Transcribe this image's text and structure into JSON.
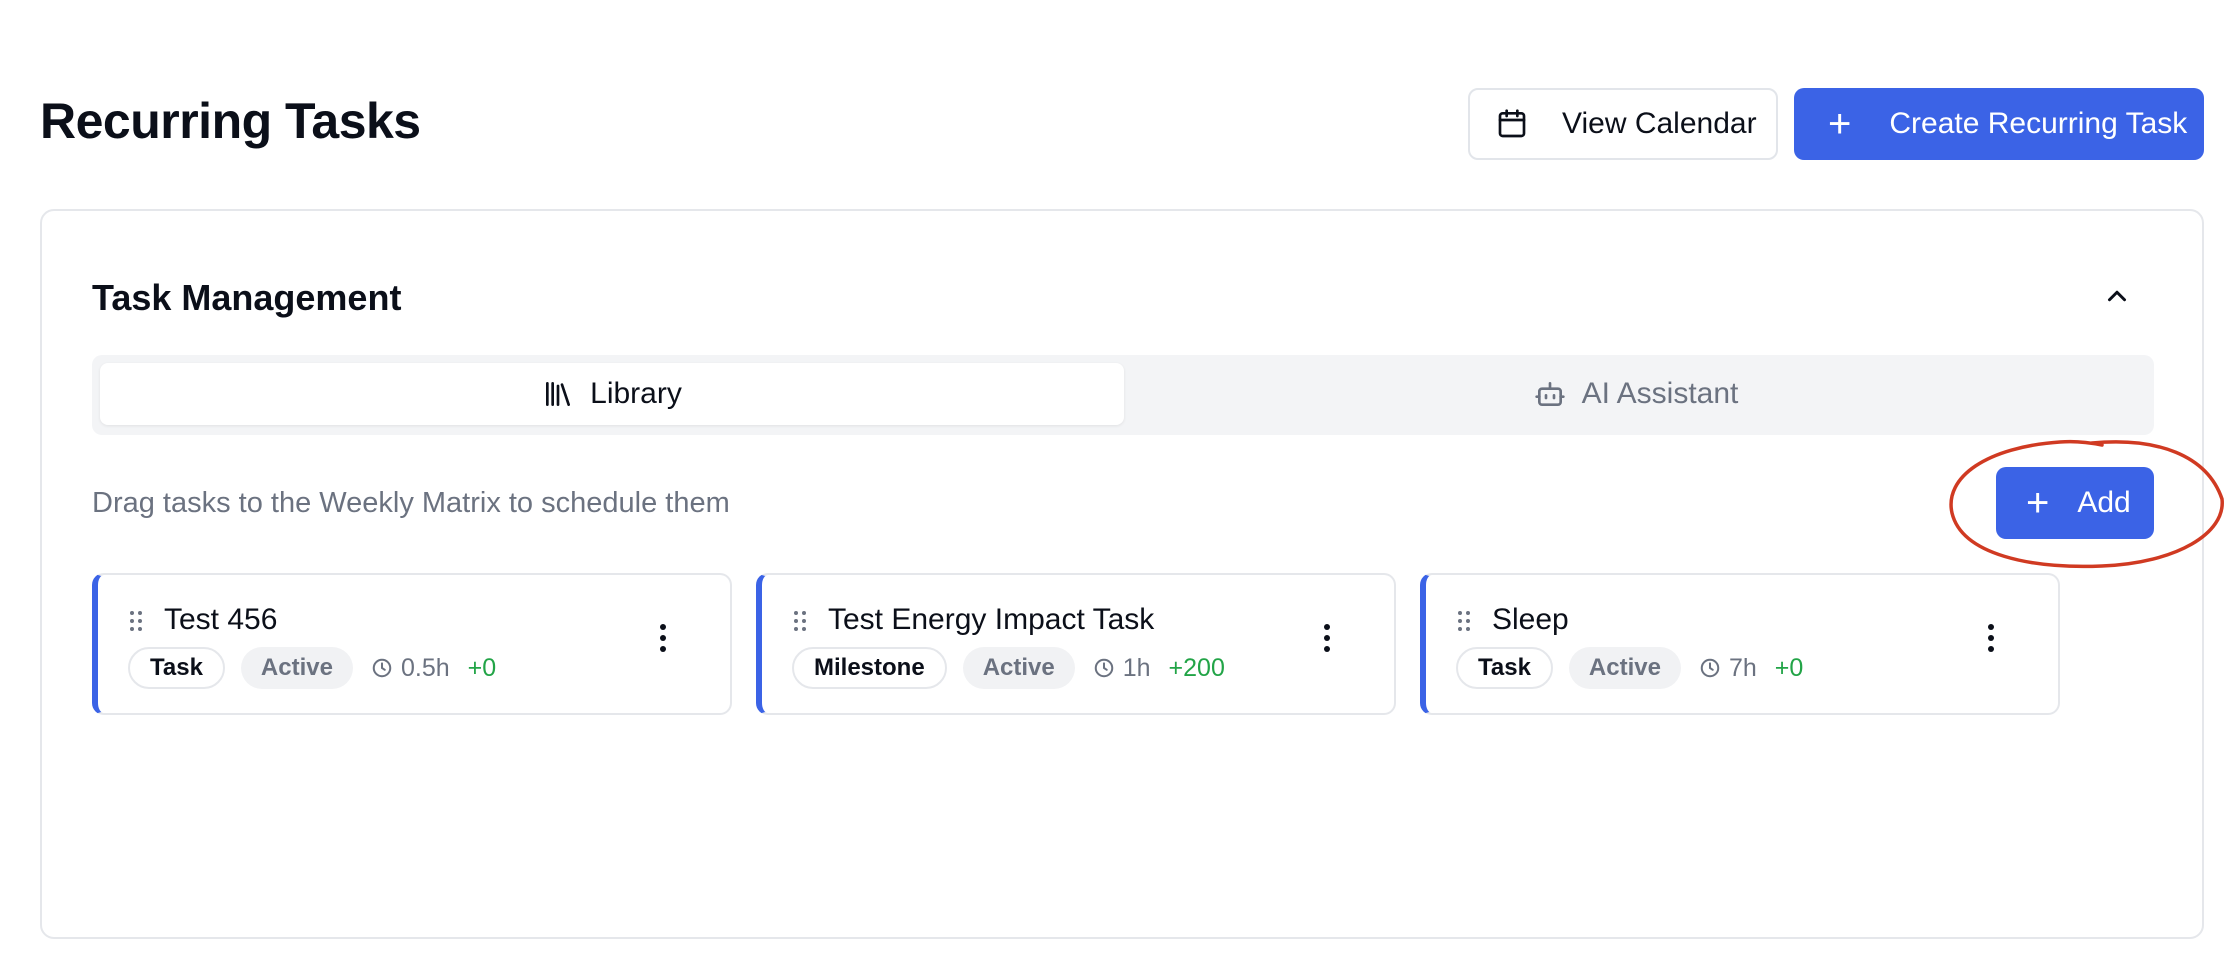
{
  "header": {
    "title": "Recurring Tasks",
    "view_calendar_label": "View Calendar",
    "create_label": "Create Recurring Task"
  },
  "panel": {
    "title": "Task Management",
    "tabs": [
      {
        "label": "Library",
        "icon": "library-icon",
        "active": true
      },
      {
        "label": "AI Assistant",
        "icon": "bot-icon",
        "active": false
      }
    ],
    "hint": "Drag tasks to the Weekly Matrix to schedule them",
    "add_label": "Add"
  },
  "tasks": [
    {
      "name": "Test 456",
      "type": "Task",
      "status": "Active",
      "duration": "0.5h",
      "energy": "+0"
    },
    {
      "name": "Test Energy Impact Task",
      "type": "Milestone",
      "status": "Active",
      "duration": "1h",
      "energy": "+200"
    },
    {
      "name": "Sleep",
      "type": "Task",
      "status": "Active",
      "duration": "7h",
      "energy": "+0"
    }
  ],
  "colors": {
    "primary": "#3b63e6",
    "energy_positive": "#22a447",
    "muted_text": "#6b7280",
    "annotation": "#d03a22"
  }
}
